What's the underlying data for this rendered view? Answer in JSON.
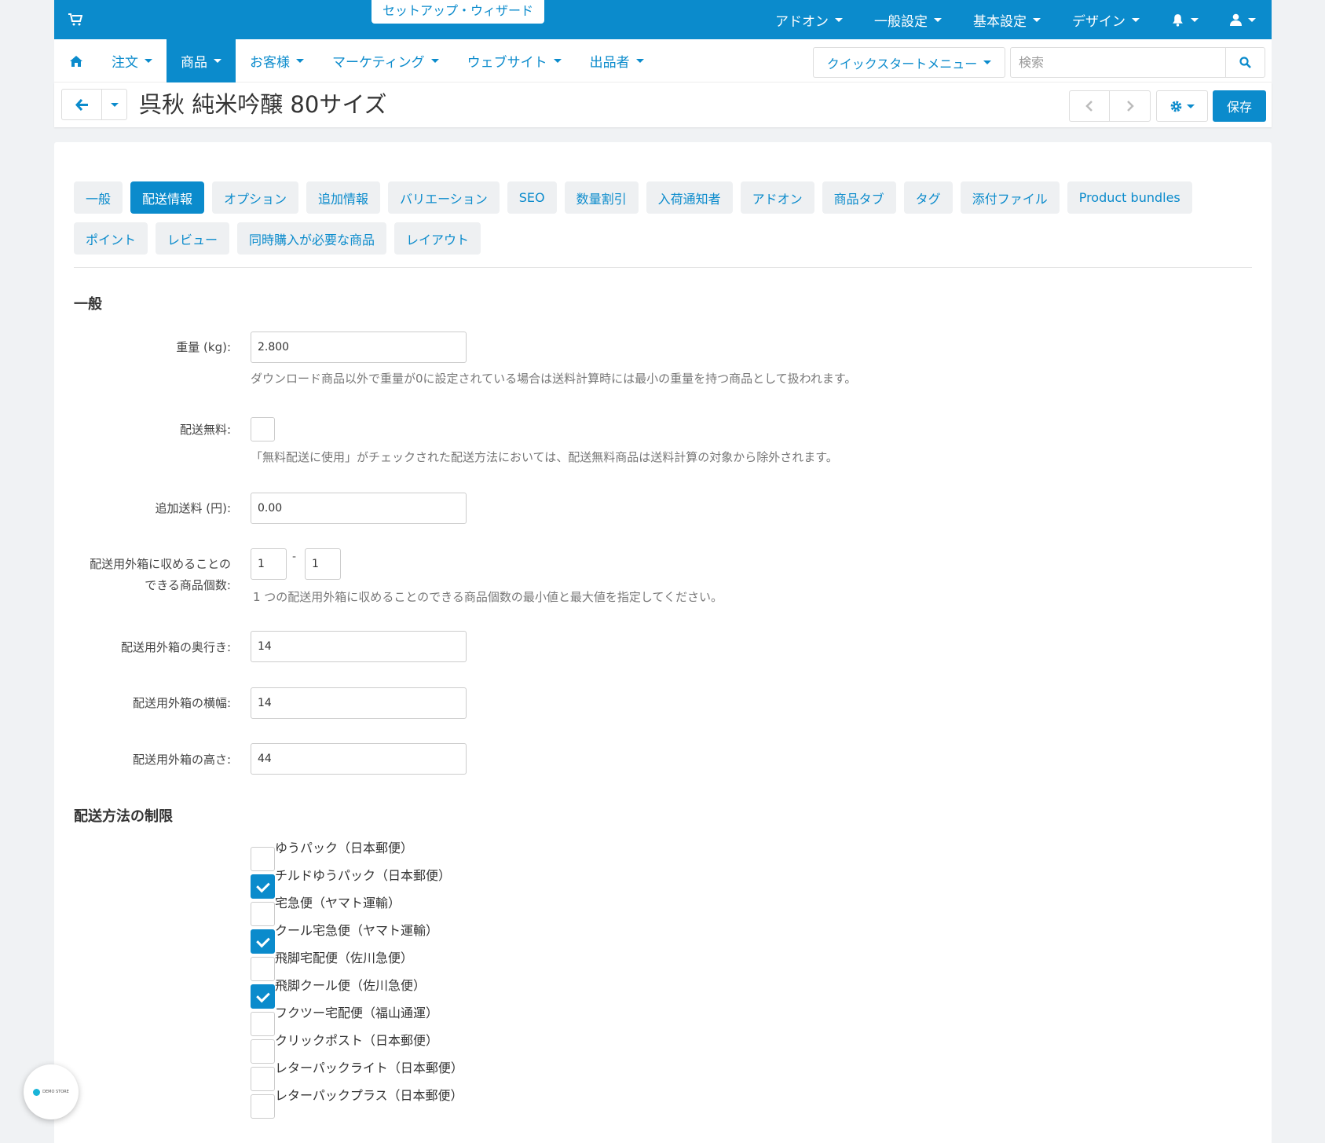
{
  "topbar": {
    "wizard": "セットアップ・ウィザード",
    "items": [
      {
        "label": "アドオン"
      },
      {
        "label": "一般設定"
      },
      {
        "label": "基本設定"
      },
      {
        "label": "デザイン"
      }
    ],
    "accent": "#0b8bcc"
  },
  "nav": {
    "items": [
      {
        "label": "注文"
      },
      {
        "label": "商品"
      },
      {
        "label": "お客様"
      },
      {
        "label": "マーケティング"
      },
      {
        "label": "ウェブサイト"
      },
      {
        "label": "出品者"
      }
    ],
    "quick_menu": "クイックスタートメニュー",
    "search_placeholder": "検索"
  },
  "page": {
    "title": "呉秋 純米吟醸 80サイズ",
    "save_label": "保存"
  },
  "tabs": [
    {
      "label": "一般"
    },
    {
      "label": "配送情報"
    },
    {
      "label": "オプション"
    },
    {
      "label": "追加情報"
    },
    {
      "label": "バリエーション"
    },
    {
      "label": "SEO"
    },
    {
      "label": "数量割引"
    },
    {
      "label": "入荷通知者"
    },
    {
      "label": "アドオン"
    },
    {
      "label": "商品タブ"
    },
    {
      "label": "タグ"
    },
    {
      "label": "添付ファイル"
    },
    {
      "label": "Product bundles"
    },
    {
      "label": "ポイント"
    },
    {
      "label": "レビュー"
    },
    {
      "label": "同時購入が必要な商品"
    },
    {
      "label": "レイアウト"
    }
  ],
  "general": {
    "heading": "一般",
    "weight_label": "重量 (kg):",
    "weight_value": "2.800",
    "weight_help": "ダウンロード商品以外で重量が0に設定されている場合は送料計算時には最小の重量を持つ商品として扱われます。",
    "free_label": "配送無料:",
    "free_help": "「無料配送に使用」がチェックされた配送方法においては、配送無料商品は送料計算の対象から除外されます。",
    "extra_label": "追加送料 (円):",
    "extra_value": "0.00",
    "items_label_1": "配送用外箱に収めることの",
    "items_label_2": "できる商品個数:",
    "items_min": "1",
    "items_sep": "-",
    "items_max": "1",
    "items_help": "1 つの配送用外箱に収めることのできる商品個数の最小値と最大値を指定してください。",
    "depth_label": "配送用外箱の奥行き:",
    "depth_value": "14",
    "width_label": "配送用外箱の横幅:",
    "width_value": "14",
    "height_label": "配送用外箱の高さ:",
    "height_value": "44"
  },
  "shipping": {
    "heading": "配送方法の制限",
    "methods": [
      {
        "label": "ゆうパック（日本郵便）",
        "checked": false
      },
      {
        "label": "チルドゆうパック（日本郵便）",
        "checked": true
      },
      {
        "label": "宅急便（ヤマト運輸）",
        "checked": false
      },
      {
        "label": "クール宅急便（ヤマト運輸）",
        "checked": true
      },
      {
        "label": "飛脚宅配便（佐川急便）",
        "checked": false
      },
      {
        "label": "飛脚クール便（佐川急便）",
        "checked": true
      },
      {
        "label": "フクツー宅配便（福山通運）",
        "checked": false
      },
      {
        "label": "クリックポスト（日本郵便）",
        "checked": false
      },
      {
        "label": "レターパックライト（日本郵便）",
        "checked": false
      },
      {
        "label": "レターパックプラス（日本郵便）",
        "checked": false
      }
    ]
  },
  "badge": {
    "label": "DEMO STORE"
  }
}
